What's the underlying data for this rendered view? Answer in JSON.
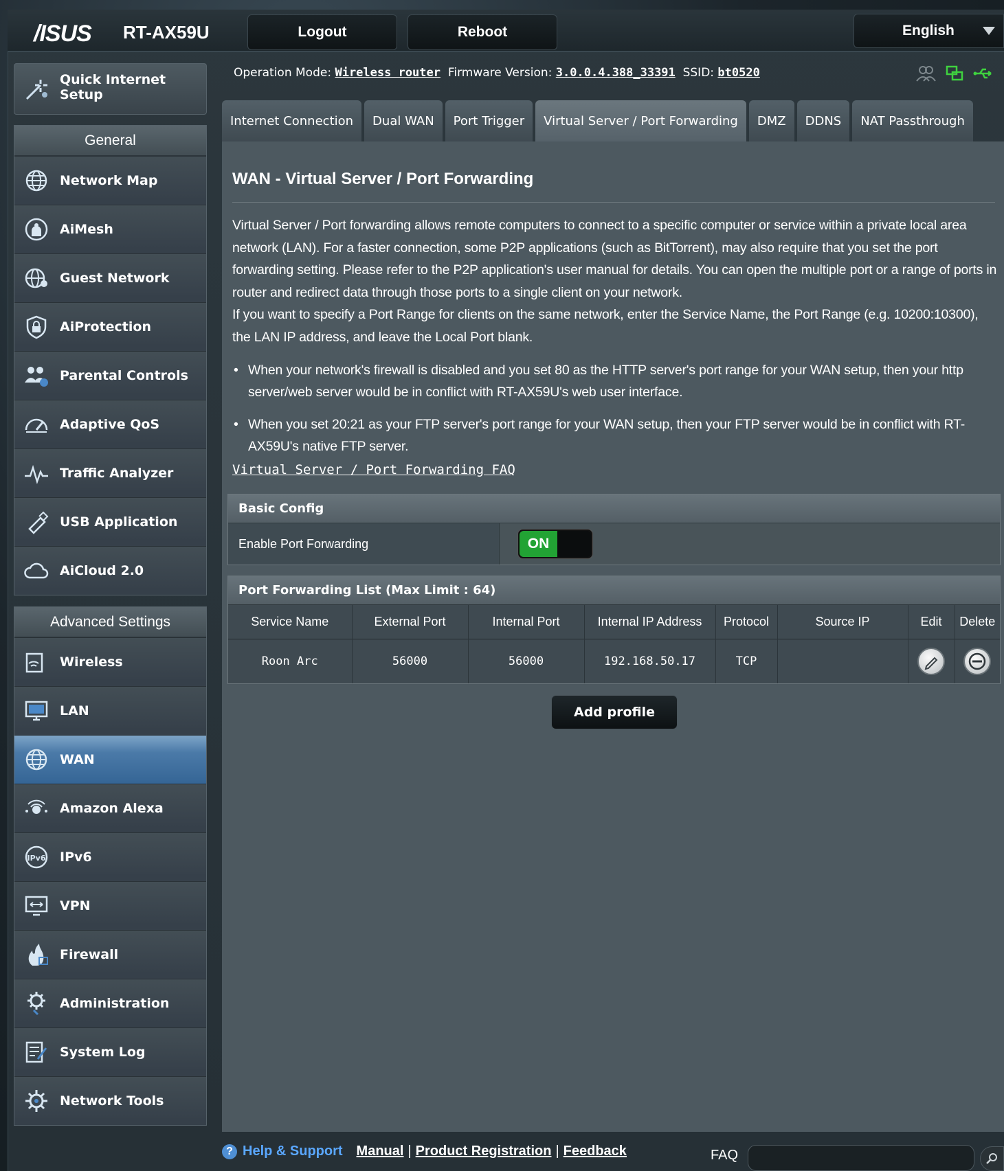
{
  "header": {
    "brand": "/ISUS",
    "model": "RT-AX59U",
    "logout_label": "Logout",
    "reboot_label": "Reboot",
    "language": "English"
  },
  "status": {
    "operation_mode_label": "Operation Mode:",
    "operation_mode": "Wireless router",
    "firmware_label": "Firmware Version:",
    "firmware": "3.0.0.4.388_33391",
    "ssid_label": "SSID:",
    "ssid": "bt0520"
  },
  "sidebar": {
    "quick_setup": "Quick Internet Setup",
    "general_heading": "General",
    "general_items": [
      {
        "label": "Network Map",
        "icon": "globe-icon"
      },
      {
        "label": "AiMesh",
        "icon": "mesh-icon"
      },
      {
        "label": "Guest Network",
        "icon": "guest-globe-icon"
      },
      {
        "label": "AiProtection",
        "icon": "shield-lock-icon"
      },
      {
        "label": "Parental Controls",
        "icon": "family-icon"
      },
      {
        "label": "Adaptive QoS",
        "icon": "gauge-icon"
      },
      {
        "label": "Traffic Analyzer",
        "icon": "pulse-icon"
      },
      {
        "label": "USB Application",
        "icon": "usb-icon"
      },
      {
        "label": "AiCloud 2.0",
        "icon": "cloud-icon"
      }
    ],
    "advanced_heading": "Advanced Settings",
    "advanced_items": [
      {
        "label": "Wireless",
        "icon": "wifi-icon"
      },
      {
        "label": "LAN",
        "icon": "monitor-icon"
      },
      {
        "label": "WAN",
        "icon": "globe-icon"
      },
      {
        "label": "Amazon Alexa",
        "icon": "alexa-icon"
      },
      {
        "label": "IPv6",
        "icon": "ipv6-icon"
      },
      {
        "label": "VPN",
        "icon": "vpn-icon"
      },
      {
        "label": "Firewall",
        "icon": "fire-icon"
      },
      {
        "label": "Administration",
        "icon": "gear-icon"
      },
      {
        "label": "System Log",
        "icon": "log-icon"
      },
      {
        "label": "Network Tools",
        "icon": "tools-gear-icon"
      }
    ],
    "active_item": "WAN"
  },
  "tabs": [
    {
      "label": "Internet Connection"
    },
    {
      "label": "Dual WAN"
    },
    {
      "label": "Port Trigger"
    },
    {
      "label": "Virtual Server / Port Forwarding"
    },
    {
      "label": "DMZ"
    },
    {
      "label": "DDNS"
    },
    {
      "label": "NAT Passthrough"
    }
  ],
  "active_tab": "Virtual Server / Port Forwarding",
  "main": {
    "title": "WAN - Virtual Server / Port Forwarding",
    "desc1": "Virtual Server / Port forwarding allows remote computers to connect to a specific computer or service within a private local area network (LAN). For a faster connection, some P2P applications (such as BitTorrent), may also require that you set the port forwarding setting. Please refer to the P2P application's user manual for details. You can open the multiple port or a range of ports in router and redirect data through those ports to a single client on your network.",
    "desc2": "If you want to specify a Port Range for clients on the same network, enter the Service Name, the Port Range (e.g. 10200:10300), the LAN IP address, and leave the Local Port blank.",
    "bullet1": "When your network's firewall is disabled and you set 80 as the HTTP server's port range for your WAN setup, then your http server/web server would be in conflict with RT-AX59U's web user interface.",
    "bullet2": "When you set 20:21 as your FTP server's port range for your WAN setup, then your FTP server would be in conflict with RT-AX59U's native FTP server.",
    "faq_link": "Virtual Server / Port Forwarding FAQ",
    "basic_config": {
      "heading": "Basic Config",
      "enable_label": "Enable Port Forwarding",
      "toggle_state": "ON"
    },
    "pf_list": {
      "heading": "Port Forwarding List (Max Limit : 64)",
      "columns": [
        "Service Name",
        "External Port",
        "Internal Port",
        "Internal IP Address",
        "Protocol",
        "Source IP",
        "Edit",
        "Delete"
      ],
      "rows": [
        {
          "service": "Roon Arc",
          "external": "56000",
          "internal": "56000",
          "ip": "192.168.50.17",
          "protocol": "TCP",
          "source": ""
        }
      ]
    },
    "add_profile": "Add profile"
  },
  "footer": {
    "help": "Help & Support",
    "manual": "Manual",
    "product_registration": "Product Registration",
    "feedback": "Feedback",
    "faq_label": "FAQ",
    "faq_placeholder": ""
  },
  "colors": {
    "active_blue": "#3a6b9c",
    "toggle_green": "#22a334",
    "status_green": "#3fd13f",
    "help_blue": "#5aa7ff"
  }
}
